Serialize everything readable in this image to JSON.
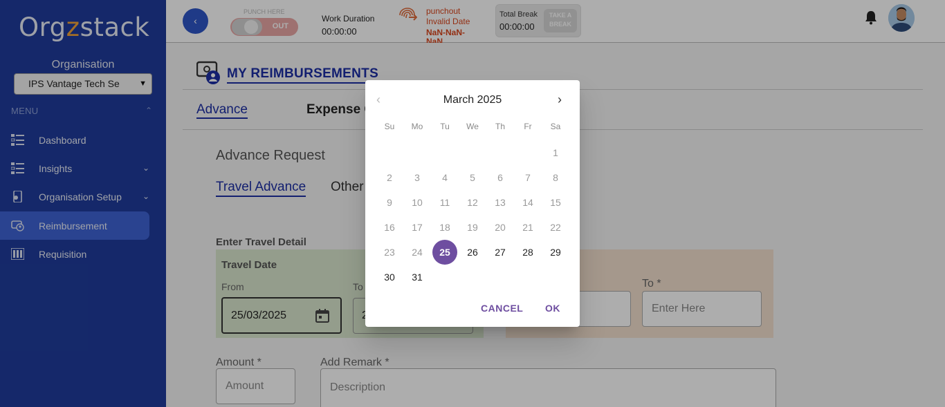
{
  "sidebar": {
    "logo": {
      "part1": "Org",
      "accent": "z",
      "part2": "stack"
    },
    "org_label": "Organisation",
    "org_select_value": "IPS Vantage Tech Se",
    "menu_label": "MENU",
    "items": [
      {
        "label": "Dashboard",
        "icon": "dashboard-icon"
      },
      {
        "label": "Insights",
        "icon": "insights-icon"
      },
      {
        "label": "Organisation Setup",
        "icon": "organisation-setup-icon"
      },
      {
        "label": "Reimbursement",
        "icon": "reimbursement-icon"
      },
      {
        "label": "Requisition",
        "icon": "requisition-icon"
      }
    ]
  },
  "topbar": {
    "back_icon": "chevron-left",
    "punch_label": "PUNCH HERE",
    "punch_state": "OUT",
    "work_duration_label": "Work Duration",
    "work_duration_value": "00:00:00",
    "punchout_label": "punchout",
    "punchout_status": "Invalid Date",
    "punchout_date": "NaN-NaN-NaN",
    "total_break_label": "Total Break",
    "total_break_value": "00:00:00",
    "take_break_label": "TAKE A BREAK"
  },
  "main": {
    "page_title": "MY REIMBURSEMENTS",
    "tabs": [
      {
        "label": "Advance",
        "active": true
      },
      {
        "label": "Expense C",
        "active": false
      }
    ],
    "section_title": "Advance Request",
    "subtabs": [
      {
        "label": "Travel Advance",
        "active": true
      },
      {
        "label": "Other",
        "active": false
      }
    ],
    "enter_label": "Enter Travel Detail",
    "travel_date_label": "Travel Date",
    "from_label": "From",
    "to_label": "To",
    "from_value": "25/03/2025",
    "to_value": "2",
    "to2_label": "To *",
    "to2_placeholder": "Enter Here",
    "amount_label": "Amount *",
    "amount_placeholder": "Amount",
    "remark_label": "Add Remark *",
    "remark_placeholder": "Description"
  },
  "datepicker": {
    "month_label": "March 2025",
    "weekdays": [
      "Su",
      "Mo",
      "Tu",
      "We",
      "Th",
      "Fr",
      "Sa"
    ],
    "first_weekday_index": 6,
    "days_in_month": 31,
    "selected_day": 25,
    "first_enabled_day": 25,
    "cancel_label": "CANCEL",
    "ok_label": "OK"
  },
  "colors": {
    "sidebar_bg": "#1f3c9c",
    "active_nav": "#3e63d4",
    "title_blue": "#1c2fa5",
    "accent_purple": "#6e4ea0",
    "punchout_red": "#d9461d"
  }
}
